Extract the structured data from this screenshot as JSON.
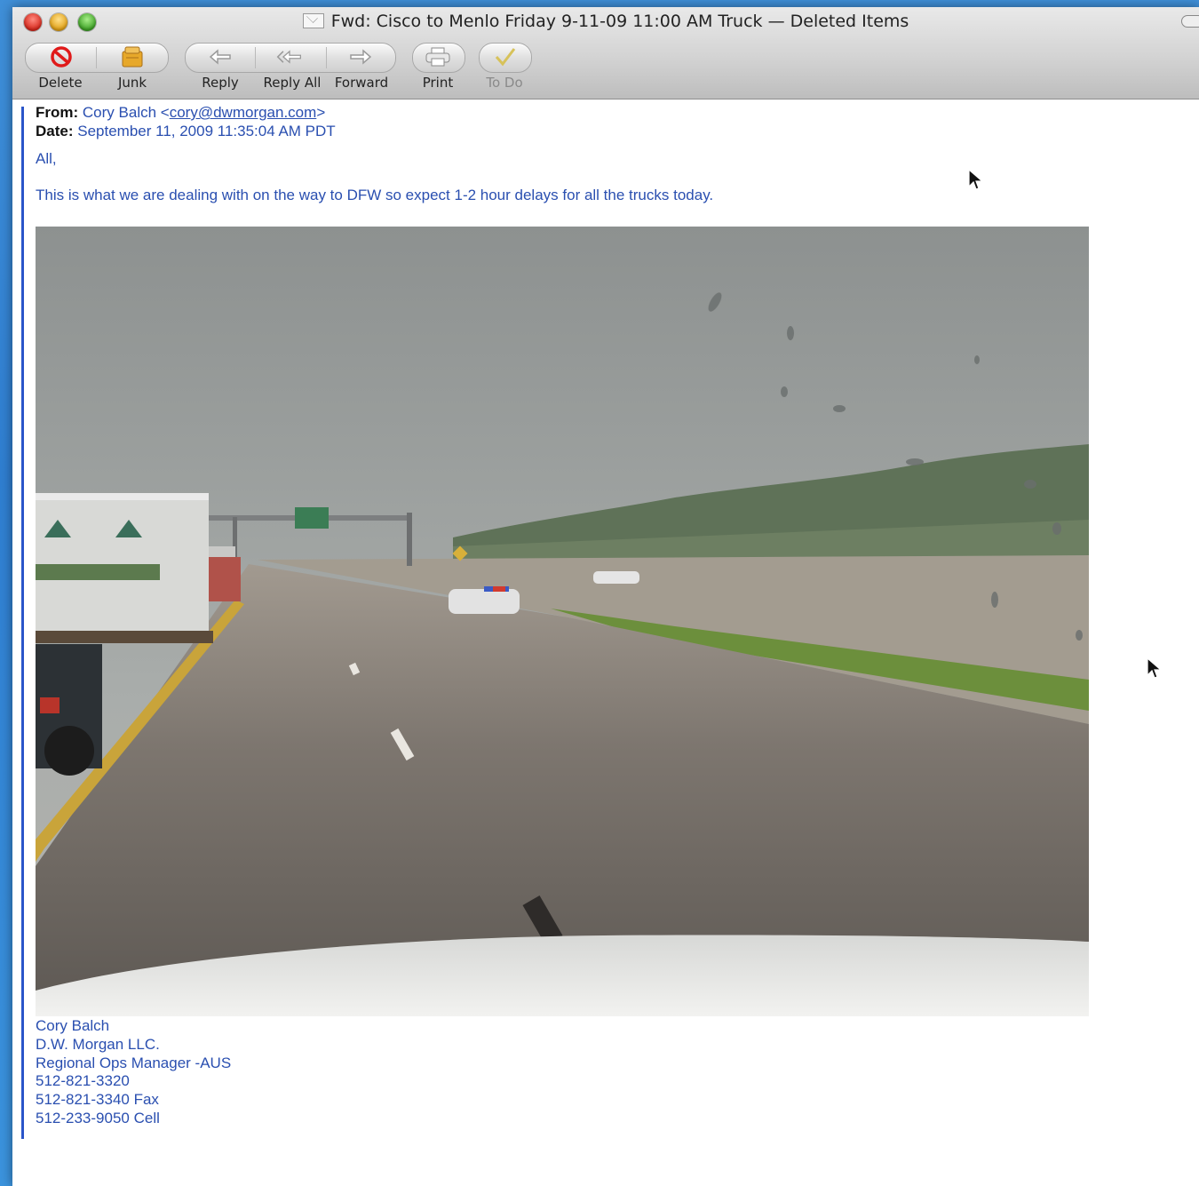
{
  "window": {
    "title": "Fwd: Cisco to Menlo Friday 9-11-09 11:00 AM Truck — Deleted Items"
  },
  "toolbar": {
    "delete": "Delete",
    "junk": "Junk",
    "reply": "Reply",
    "reply_all": "Reply All",
    "forward": "Forward",
    "print": "Print",
    "todo": "To Do"
  },
  "message": {
    "from_label": "From:",
    "from_name": "Cory Balch",
    "from_email": "cory@dwmorgan.com",
    "date_label": "Date:",
    "date": "September 11, 2009 11:35:04 AM PDT",
    "greeting": "All,",
    "body": "This is what we are dealing with on the way to DFW so expect 1-2 hour delays for all the trucks today.",
    "signature": [
      "Cory Balch",
      "D.W. Morgan LLC.",
      "Regional Ops Manager -AUS",
      "512-821-3320",
      "512-821-3340 Fax",
      "512-233-9050 Cell"
    ]
  },
  "icons": {
    "delete": "no-entry-icon",
    "junk": "junk-bag-icon",
    "reply": "reply-arrow-icon",
    "reply_all": "reply-all-arrow-icon",
    "forward": "forward-arrow-icon",
    "print": "printer-icon",
    "todo": "checkmark-icon"
  },
  "colors": {
    "link_blue": "#2a4fb0",
    "quote_bar": "#2a55c9",
    "desktop": "#2f7ed0"
  }
}
